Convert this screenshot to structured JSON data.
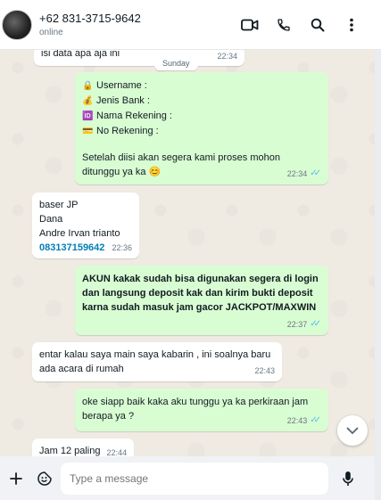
{
  "header": {
    "contact_name": "+62 831-3715-9642",
    "status": "online"
  },
  "chat": {
    "date_chip": "Sunday",
    "messages": [
      {
        "text": "isi data apa aja ini",
        "time": "22:34"
      },
      {
        "lines": [
          {
            "icon": "🔒",
            "text": "Username :"
          },
          {
            "icon": "💰",
            "text": "Jenis Bank :"
          },
          {
            "icon": "🆔",
            "text": "Nama Rekening :"
          },
          {
            "icon": "💳",
            "text": "No Rekening :"
          }
        ],
        "footer_line1": "Setelah diisi akan segera kami proses mohon",
        "footer_line2": "ditunggu ya ka 😊",
        "time": "22:34"
      },
      {
        "line1": "baser JP",
        "line2": "Dana",
        "line3": "Andre Irvan trianto",
        "line4": "083137159642",
        "time": "22:36"
      },
      {
        "line1": "AKUN kakak sudah bisa digunakan segera di login",
        "line2": "dan langsung deposit kak dan kirim bukti deposit",
        "line3": "karna sudah masuk jam gacor JACKPOT/MAXWIN",
        "time": "22:37"
      },
      {
        "line1": "entar kalau saya main saya kabarin , ini soalnya baru",
        "line2": "ada acara di rumah",
        "time": "22:43"
      },
      {
        "line1": "oke siapp baik kaka aku tunggu ya ka perkiraan jam",
        "line2": "berapa ya ?",
        "time": "22:43"
      },
      {
        "text": "Jam 12 paling",
        "time": "22:44"
      }
    ]
  },
  "composer": {
    "placeholder": "Type a message"
  },
  "icons": {
    "video": "video-call-icon",
    "phone": "voice-call-icon",
    "search": "search-icon",
    "menu": "menu-icon",
    "plus": "plus-icon",
    "emoji": "emoji-icon",
    "mic": "mic-icon",
    "scroll": "chevron-down-icon"
  },
  "colors": {
    "incoming": "#ffffff",
    "outgoing": "#d9fdd3",
    "read_ticks": "#53bdeb",
    "background": "#efeae2"
  }
}
